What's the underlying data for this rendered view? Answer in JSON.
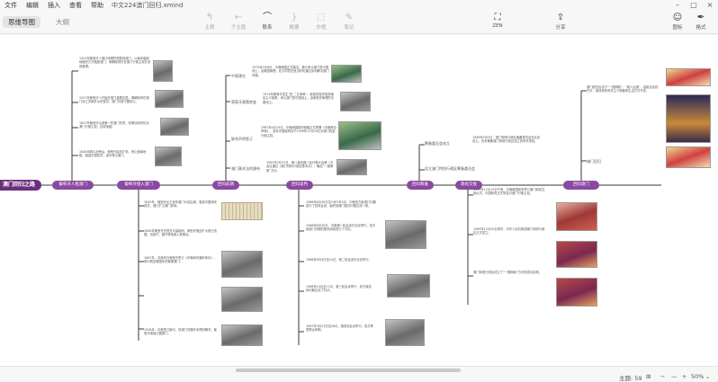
{
  "menubar": {
    "items": [
      "文件",
      "编辑",
      "插入",
      "查看",
      "帮助"
    ],
    "document_title": "中文224澳门回归.xmind"
  },
  "toolbar": {
    "view_tabs": [
      "思维导图",
      "大纲"
    ],
    "buttons": [
      {
        "label": "主题",
        "icon": "subtopic-icon",
        "glyph": "↰"
      },
      {
        "label": "子主题",
        "icon": "child-topic-icon",
        "glyph": "←"
      },
      {
        "label": "联系",
        "icon": "relationship-icon",
        "glyph": "⌒"
      },
      {
        "label": "概要",
        "icon": "summary-icon",
        "glyph": "}"
      },
      {
        "label": "外框",
        "icon": "boundary-icon",
        "glyph": "⬚"
      },
      {
        "label": "笔记",
        "icon": "note-icon",
        "glyph": "✎"
      },
      {
        "label": "ZEN",
        "icon": "zen-icon",
        "glyph": "⛶"
      },
      {
        "label": "分享",
        "icon": "share-icon",
        "glyph": "⇪"
      },
      {
        "label": "图标",
        "icon": "emoji-icon",
        "glyph": "☺"
      },
      {
        "label": "格式",
        "icon": "format-brush-icon",
        "glyph": "✒"
      }
    ]
  },
  "map": {
    "root": "澳门回归之路",
    "branches": [
      "葡萄牙人租澳门",
      "葡萄牙侵入澳门",
      "回归前期",
      "回归谈判",
      "回归筹备",
      "政权交接",
      "回归澳门"
    ],
    "subtopics": [
      "中葡建交",
      "葡萄牙政策转变",
      "联合声明签订",
      "澳门基本法的颁布",
      "筹备委员会成立",
      "设立澳门特别行政区筹备委员会",
      "澳门回归"
    ],
    "texts": [
      "1553年葡萄牙人借口晾晒货物登陆澳门，以每年缴纳地租的方式租居澳门，明朝政府仍在澳门行使主权并设官管理。",
      "1557年葡萄牙人开始在澳门建屋定居，明朝政府在澳门设立关闸并派驻官员，澳门仍是中国领土。",
      "1623年葡萄牙派遣第一任澳门总督，但明清政府仍对澳门行使主权，征收地租。",
      "1840年鸦片战争后，葡萄牙趁机扩张，停止缴纳地租，驱逐中国官员，逐步侵占澳门。",
      "1845年，葡萄牙女王宣布澳门为自由港，驱逐中国海关官员，强行扩占澳门领地。",
      "1849年葡萄牙总督亚马留被刺，葡萄牙借此扩大侵占范围，将氹仔、路环等地纳入其管治。",
      "1887年，清政府与葡萄牙签订《中葡和好通商条约》，条约规定葡国永驻管理澳门。",
      "1928年，中葡签订新约，但澳门问题仍未得到解决，葡萄牙继续占据澳门。",
      "1979年2月8日，中葡两国正式建交。葡方承认澳门是中国领土，由葡国管理，双方同意在适当时机通过谈判解决澳门问题。",
      "1974年葡萄牙发生“四·二五革命”，新政府宣布放弃殖民主义政策，承认澳门是中国领土，由葡萄牙管理的中国领土。",
      "1987年4月13日，中葡两国政府首脑正式签署《中葡联合声明》，宣布中国政府将于1999年12月20日对澳门恢复行使主权。",
      "1993年3月31日，第八届全国人民代表大会第一次会议通过《澳门特别行政区基本法》，确定“一国两制”方针。",
      "1986年6月30日至1987年3月，中葡双方就澳门问题进行了四轮会谈，最终就澳门回归问题达成一致。",
      "1986年6月30日，中葡第一轮会谈在北京举行，双方就澳门问题的基本原则进行了讨论。",
      "1986年9月9日至10日，第二轮会谈在北京举行。",
      "1986年10月至11月，第三轮会谈举行，双方就具体问题达成了共识。",
      "1987年3月23日至26日，第四轮会谈举行，双方草签联合声明。",
      "1998年5月5日，澳门特别行政区筹备委员会在北京成立，负责筹备澳门特别行政区成立的有关事宜。",
      "1999年12月19日午夜，中葡两国政府举行澳门政权交接仪式，中国政府正式恢复对澳门行使主权。",
      "1999年12月20日零时，中华人民共和国澳门特别行政区正式成立。",
      "澳门特别行政区成立了“一国两制”方针的成功实践。",
      "澳门回归后实行“一国两制”、“澳人治澳”、高度自治的方针，保持原有资本主义制度和生活方式不变。"
    ]
  },
  "status": {
    "topic_count": "主题: 59",
    "zoom": "50%"
  }
}
